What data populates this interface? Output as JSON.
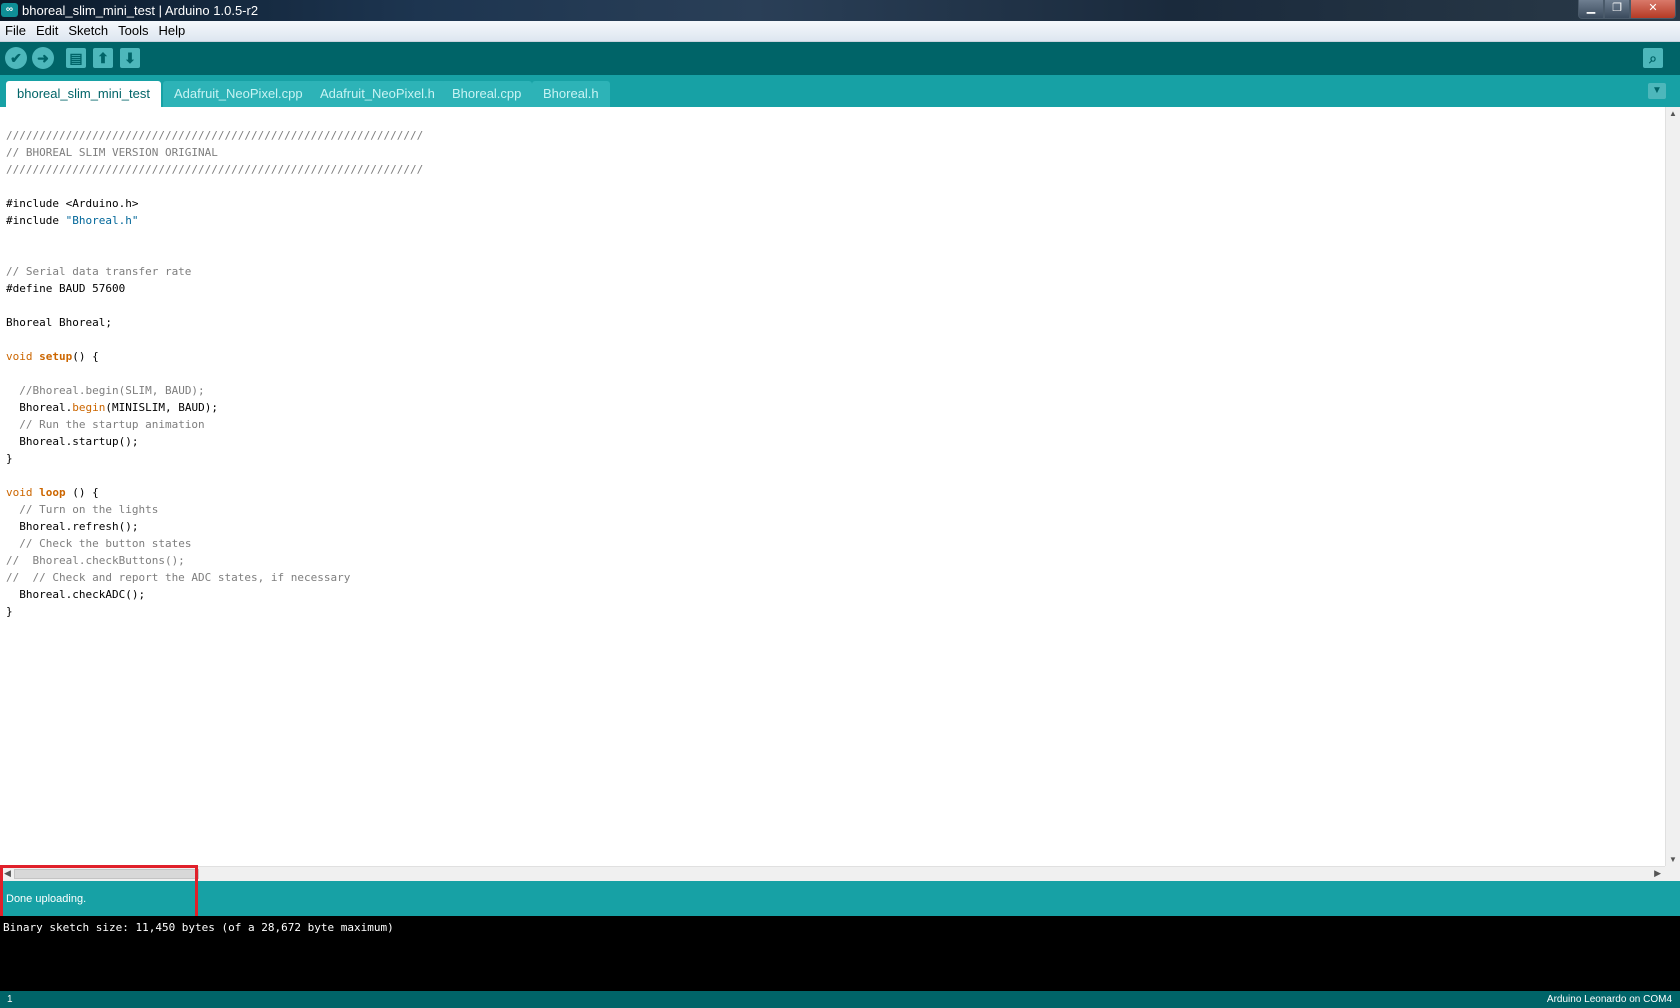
{
  "window": {
    "title": "bhoreal_slim_mini_test | Arduino 1.0.5-r2",
    "logo_glyph": "∞",
    "minimize_glyph": "▁",
    "maximize_glyph": "❐",
    "close_glyph": "✕"
  },
  "menu": {
    "items": [
      "File",
      "Edit",
      "Sketch",
      "Tools",
      "Help"
    ]
  },
  "toolbar": {
    "verify_icon": "✔",
    "upload_icon": "➜",
    "new_icon": "▤",
    "open_icon": "⬆",
    "save_icon": "⬇",
    "serial_monitor_icon": "⌕"
  },
  "tabs": {
    "items": [
      "bhoreal_slim_mini_test",
      "Adafruit_NeoPixel.cpp",
      "Adafruit_NeoPixel.h",
      "Bhoreal.cpp",
      "Bhoreal.h"
    ],
    "active_index": 0,
    "menu_glyph": "▼"
  },
  "editor": {
    "lines": [
      "///////////////////////////////////////////////////////////////",
      "// BHOREAL SLIM VERSION ORIGINAL",
      "///////////////////////////////////////////////////////////////",
      "",
      "#include <Arduino.h>",
      "#include \"Bhoreal.h\"",
      "",
      "",
      "// Serial data transfer rate",
      "#define BAUD 57600",
      "",
      "Bhoreal Bhoreal;",
      "",
      "void setup() {",
      "",
      "  //Bhoreal.begin(SLIM, BAUD);",
      "  Bhoreal.begin(MINISLIM, BAUD);",
      "  // Run the startup animation",
      "  Bhoreal.startup();",
      "}",
      "",
      "void loop () {",
      "  // Turn on the lights",
      "  Bhoreal.refresh();",
      "  // Check the button states",
      "//  Bhoreal.checkButtons();",
      "//  // Check and report the ADC states, if necessary",
      "  Bhoreal.checkADC();",
      "}"
    ]
  },
  "status": {
    "message": "Done uploading."
  },
  "console": {
    "output": "Binary sketch size: 11,450 bytes (of a 28,672 byte maximum)"
  },
  "bottom": {
    "line_number": "1",
    "board": "Arduino Leonardo on COM4"
  }
}
